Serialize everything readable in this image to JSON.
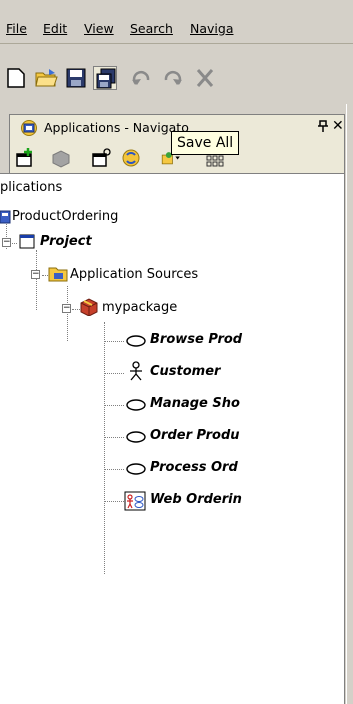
{
  "menubar": {
    "items": [
      {
        "label": "File"
      },
      {
        "label": "Edit"
      },
      {
        "label": "View"
      },
      {
        "label": "Search"
      },
      {
        "label": "Naviga"
      }
    ]
  },
  "toolbar": {
    "buttons": [
      "new-icon",
      "open-folder-icon",
      "save-icon",
      "save-all-icon",
      "undo-icon",
      "redo-icon",
      "cut-icon"
    ]
  },
  "panel": {
    "title": "Applications - Navigato",
    "pin_glyph": "ᵖ",
    "close_glyph": "✕",
    "tooltip": "Save All"
  },
  "tree": {
    "root_label": "plications",
    "app_label": "ProductOrdering",
    "project_label": "Project",
    "sources_label": "Application Sources",
    "package_label": "mypackage",
    "items": [
      {
        "label": "Browse Prod",
        "type": "use-case"
      },
      {
        "label": "Customer",
        "type": "actor"
      },
      {
        "label": "Manage Sho",
        "type": "use-case"
      },
      {
        "label": "Order Produ",
        "type": "use-case"
      },
      {
        "label": "Process Ord",
        "type": "use-case"
      },
      {
        "label": "Web Orderin",
        "type": "diagram"
      }
    ]
  },
  "colors": {
    "chrome": "#d4d0c8",
    "tab": "#ece9d8",
    "tooltip_bg": "#ffffe1",
    "tree_bg": "#ffffff"
  }
}
